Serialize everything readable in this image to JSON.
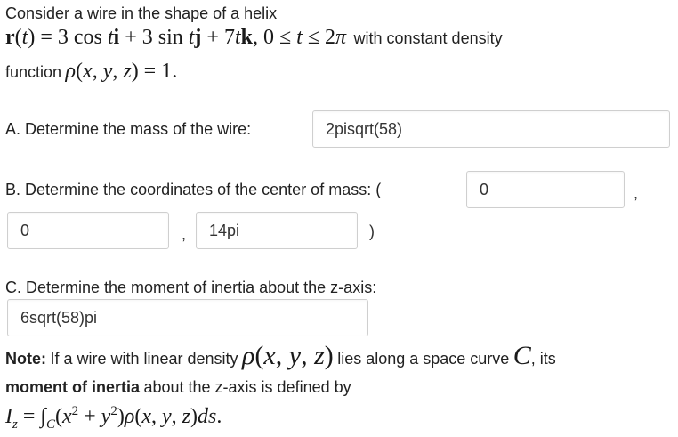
{
  "problem": {
    "intro": "Consider a wire in the shape of a helix",
    "with_density": "with constant density",
    "function_label": "function"
  },
  "part_a": {
    "label": "A. Determine the mass of the wire:",
    "answer": "2pisqrt(58)"
  },
  "part_b": {
    "label": "B. Determine the coordinates of the center of mass: (",
    "x_answer": "0",
    "comma1": ",",
    "y_answer": "0",
    "comma2": ",",
    "z_answer": "14pi",
    "close_paren": ")"
  },
  "part_c": {
    "label": "C. Determine the moment of inertia about the z-axis:",
    "answer": "6sqrt(58)pi"
  },
  "note": {
    "label": "Note:",
    "text1": "If a wire with linear density",
    "text2": "lies along a space curve",
    "text3": ", its",
    "moment_bold": "moment of inertia",
    "text4": "about the z-axis is defined by"
  }
}
